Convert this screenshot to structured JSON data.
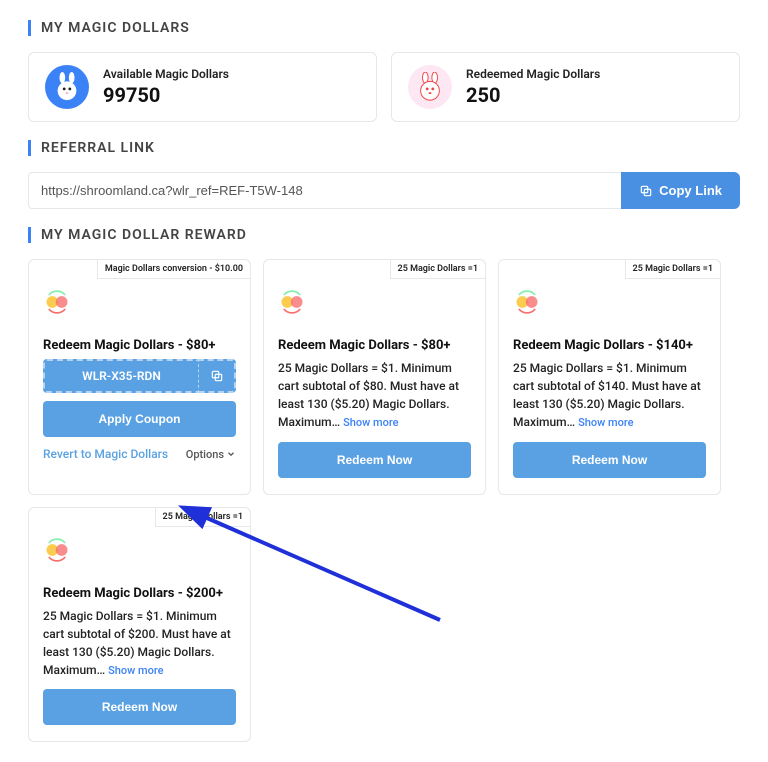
{
  "titles": {
    "magic_dollars": "MY MAGIC DOLLARS",
    "referral": "REFERRAL LINK",
    "reward": "MY MAGIC DOLLAR REWARD"
  },
  "stats": {
    "available_label": "Available Magic Dollars",
    "available_value": "99750",
    "redeemed_label": "Redeemed Magic Dollars",
    "redeemed_value": "250"
  },
  "referral": {
    "url": "https://shroomland.ca?wlr_ref=REF-T5W-148",
    "copy_label": "Copy Link"
  },
  "rewards": [
    {
      "tag": "Magic Dollars conversion - $10.00",
      "title": "Redeem Magic Dollars - $80+",
      "coupon_code": "WLR-X35-RDN",
      "apply_label": "Apply Coupon",
      "revert_label": "Revert to Magic Dollars",
      "options_label": "Options"
    },
    {
      "tag": "25 Magic Dollars =1",
      "title": "Redeem Magic Dollars - $80+",
      "desc": "25 Magic Dollars = $1. Minimum cart subtotal of $80. Must have at least 130 ($5.20) Magic Dollars. Maximum…",
      "show_more": "Show more",
      "redeem_label": "Redeem Now"
    },
    {
      "tag": "25 Magic Dollars =1",
      "title": "Redeem Magic Dollars - $140+",
      "desc": "25 Magic Dollars = $1. Minimum cart subtotal of $140. Must have at least 130 ($5.20) Magic Dollars. Maximum…",
      "show_more": "Show more",
      "redeem_label": "Redeem Now"
    },
    {
      "tag": "25 Magic Dollars =1",
      "title": "Redeem Magic Dollars - $200+",
      "desc": "25 Magic Dollars = $1. Minimum cart subtotal of $200. Must have at least 130 ($5.20) Magic Dollars. Maximum…",
      "show_more": "Show more",
      "redeem_label": "Redeem Now"
    }
  ]
}
